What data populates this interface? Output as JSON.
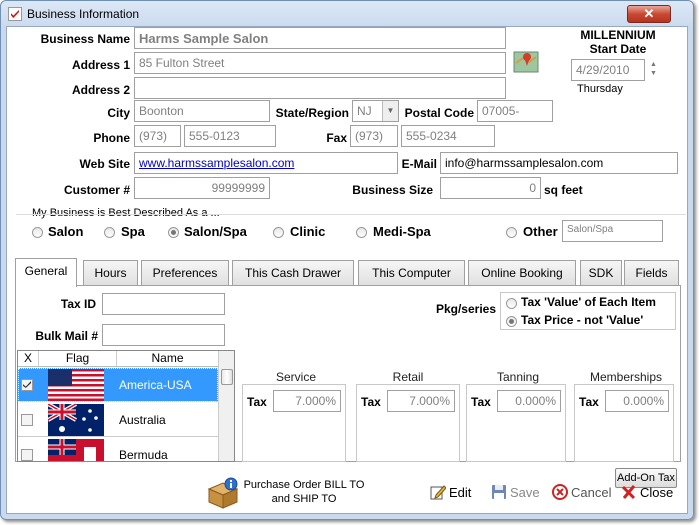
{
  "window": {
    "title": "Business Information",
    "close_label": "✕"
  },
  "labels": {
    "business_name": "Business Name",
    "address1": "Address 1",
    "address2": "Address 2",
    "city": "City",
    "state": "State/Region",
    "postal": "Postal Code",
    "phone": "Phone",
    "fax": "Fax",
    "website": "Web Site",
    "email": "E-Mail",
    "customer": "Customer #",
    "business_size": "Business Size",
    "sq_feet": "sq feet",
    "best_described": "My Business is Best Described As a ..."
  },
  "fields": {
    "business_name": "Harms Sample Salon",
    "address1": "85 Fulton Street",
    "address2": "",
    "city": "Boonton",
    "state": "NJ",
    "postal": "07005-",
    "phone_area": "(973)",
    "phone_number": "555-0123",
    "fax_area": "(973)",
    "fax_number": "555-0234",
    "website": "www.harmssamplesalon.com",
    "email": "info@harmssamplesalon.com",
    "customer": "99999999",
    "business_size": "0",
    "other_value": "Salon/Spa"
  },
  "millennium": {
    "line1": "MILLENNIUM",
    "line2": "Start Date",
    "date": "4/29/2010",
    "weekday": "Thursday"
  },
  "business_types": {
    "salon": "Salon",
    "spa": "Spa",
    "salon_spa": "Salon/Spa",
    "clinic": "Clinic",
    "medi_spa": "Medi-Spa",
    "other": "Other",
    "selected": "Salon/Spa"
  },
  "tabs": [
    "General",
    "Hours",
    "Preferences",
    "This Cash Drawer",
    "This Computer",
    "Online Booking",
    "SDK",
    "Fields"
  ],
  "general": {
    "tax_id_label": "Tax ID",
    "bulk_mail_label": "Bulk Mail #",
    "tax_id": "",
    "bulk_mail": "",
    "pkg_label": "Pkg/series",
    "pkg_option1": "Tax 'Value' of Each Item",
    "pkg_option2": "Tax Price - not 'Value'",
    "grid_headers": {
      "x": "X",
      "flag": "Flag",
      "name": "Name"
    },
    "countries": [
      {
        "name": "America-USA",
        "checked": true
      },
      {
        "name": "Australia",
        "checked": false
      },
      {
        "name": "Bermuda",
        "checked": false
      }
    ],
    "taxes": [
      {
        "title": "Service",
        "label": "Tax",
        "value": "7.000%"
      },
      {
        "title": "Retail",
        "label": "Tax",
        "value": "7.000%"
      },
      {
        "title": "Tanning",
        "label": "Tax",
        "value": "0.000%"
      },
      {
        "title": "Memberships",
        "label": "Tax",
        "value": "0.000%"
      }
    ],
    "addon_tax": "Add-On Tax"
  },
  "footer": {
    "purchase_line1": "Purchase Order BILL TO",
    "purchase_line2": "and SHIP TO",
    "edit": "Edit",
    "save": "Save",
    "cancel": "Cancel",
    "close": "Close"
  }
}
